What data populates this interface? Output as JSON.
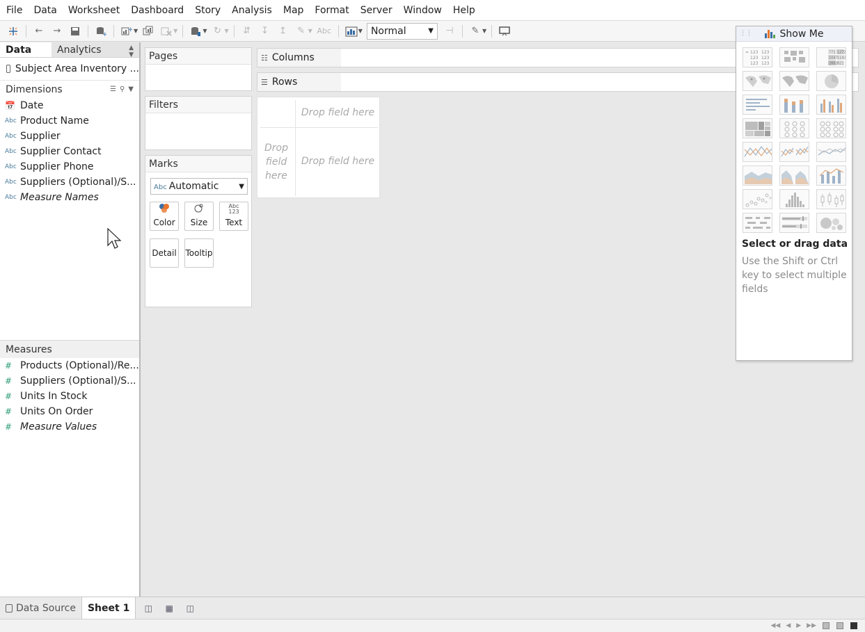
{
  "menu": [
    "File",
    "Data",
    "Worksheet",
    "Dashboard",
    "Story",
    "Analysis",
    "Map",
    "Format",
    "Server",
    "Window",
    "Help"
  ],
  "toolbar": {
    "fit_value": "Normal",
    "label_tool": "Abc"
  },
  "data_pane": {
    "tabs": [
      "Data",
      "Analytics"
    ],
    "datasource": "Subject Area Inventory ...",
    "dimensions_title": "Dimensions",
    "dimensions": [
      {
        "label": "Date",
        "type": "date"
      },
      {
        "label": "Product Name",
        "type": "abc"
      },
      {
        "label": "Supplier",
        "type": "abc"
      },
      {
        "label": "Supplier Contact",
        "type": "abc"
      },
      {
        "label": "Supplier Phone",
        "type": "abc"
      },
      {
        "label": "Suppliers (Optional)/S...",
        "type": "abc"
      },
      {
        "label": "Measure Names",
        "type": "abc",
        "italic": true
      }
    ],
    "measures_title": "Measures",
    "measures": [
      {
        "label": "Products (Optional)/Re...",
        "italic": false
      },
      {
        "label": "Suppliers (Optional)/S...",
        "italic": false
      },
      {
        "label": "Units In Stock",
        "italic": false
      },
      {
        "label": "Units On Order",
        "italic": false
      },
      {
        "label": "Measure Values",
        "italic": true
      }
    ],
    "abc_icon": "Abc",
    "hash_icon": "#"
  },
  "shelves": {
    "pages": "Pages",
    "filters": "Filters",
    "marks": "Marks",
    "columns": "Columns",
    "rows": "Rows"
  },
  "marks": {
    "type": "Automatic",
    "type_icon": "Abc",
    "buttons": {
      "color": "Color",
      "size": "Size",
      "text": "Text",
      "detail": "Detail",
      "tooltip": "Tooltip"
    },
    "text_icon_top": "Abc",
    "text_icon_bottom": "123"
  },
  "viz": {
    "drop_top": "Drop field here",
    "drop_left": "Drop field here",
    "drop_center": "Drop field here"
  },
  "show_me": {
    "title": "Show Me",
    "select_title": "Select or drag data",
    "hint": "Use the Shift or Ctrl key to select multiple fields",
    "chart_types": [
      "text-table-icon",
      "heat-map-icon",
      "highlight-table-icon",
      "symbol-map-icon",
      "filled-map-icon",
      "pie-chart-icon",
      "horizontal-bars-icon",
      "stacked-bars-icon",
      "side-by-side-bars-icon",
      "treemap-icon",
      "circle-views-icon",
      "side-by-side-circles-icon",
      "continuous-lines-icon",
      "discrete-lines-icon",
      "dual-lines-icon",
      "area-continuous-icon",
      "area-discrete-icon",
      "dual-combination-icon",
      "scatter-plot-icon",
      "histogram-icon",
      "box-whisker-icon",
      "gantt-chart-icon",
      "bullet-graph-icon",
      "packed-bubbles-icon"
    ],
    "highlight_table_nums": [
      "772",
      "1272",
      "1047",
      "1142",
      "2882",
      "821"
    ],
    "text_table_nums": [
      "123",
      "123",
      "123",
      "123",
      "123",
      "123"
    ]
  },
  "tabs": {
    "data_source": "Data Source",
    "sheet": "Sheet 1"
  },
  "colors": {
    "accent_blue": "#4a7b9a",
    "measure_green": "#2e9e76",
    "showme_header": "#eef1f7"
  }
}
